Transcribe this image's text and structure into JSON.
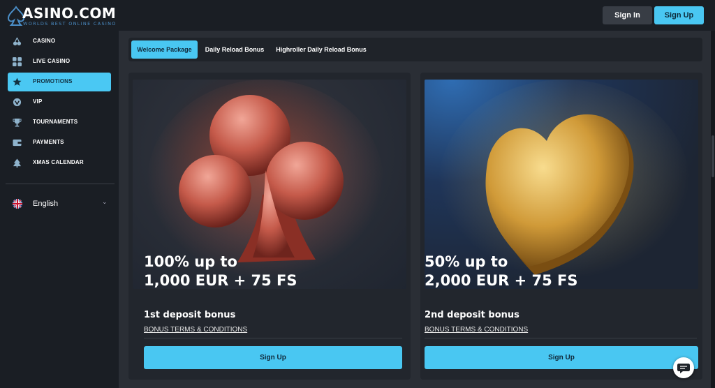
{
  "brand": {
    "name": "ASINO.COM",
    "tagline": "WORLDS BEST ONLINE CASINO",
    "accent": "#49c7f2"
  },
  "header": {
    "signin_label": "Sign In",
    "signup_label": "Sign Up"
  },
  "sidebar": {
    "items": [
      {
        "label": "CASINO",
        "icon": "cherries-icon"
      },
      {
        "label": "LIVE CASINO",
        "icon": "live-grid-icon"
      },
      {
        "label": "PROMOTIONS",
        "icon": "star-icon",
        "active": true
      },
      {
        "label": "VIP",
        "icon": "vip-shield-icon"
      },
      {
        "label": "TOURNAMENTS",
        "icon": "trophy-icon"
      },
      {
        "label": "PAYMENTS",
        "icon": "wallet-icon"
      },
      {
        "label": "XMAS CALENDAR",
        "icon": "xmas-tree-icon"
      }
    ],
    "language": {
      "label": "English",
      "icon": "uk-flag-icon"
    }
  },
  "tabs": [
    {
      "label": "Welcome Package",
      "active": true
    },
    {
      "label": "Daily Reload Bonus"
    },
    {
      "label": "Highroller Daily Reload Bonus"
    }
  ],
  "promos": [
    {
      "headline": "100% up to\n1,000 EUR + 75 FS",
      "subtitle": "1st deposit bonus",
      "terms": "BONUS TERMS & CONDITIONS",
      "cta": "Sign Up",
      "art": "club-suit-icon"
    },
    {
      "headline": "50% up to\n2,000 EUR + 75 FS",
      "subtitle": "2nd deposit bonus",
      "terms": "BONUS TERMS & CONDITIONS",
      "cta": "Sign Up",
      "art": "heart-suit-icon"
    }
  ]
}
